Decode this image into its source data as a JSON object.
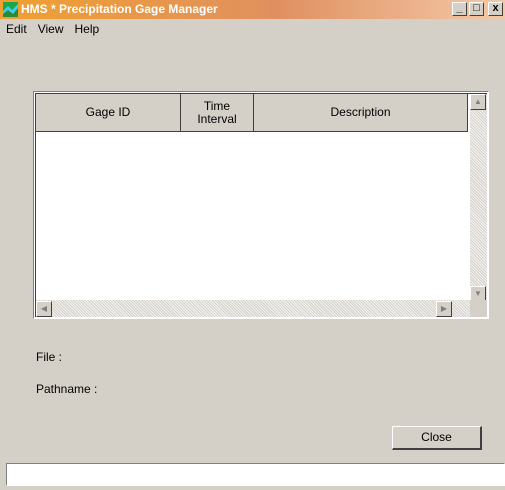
{
  "window": {
    "title": "HMS * Precipitation Gage Manager",
    "controls": {
      "minimize": "_",
      "maximize": "□",
      "close": "x"
    }
  },
  "menu": {
    "items": [
      "Edit",
      "View",
      "Help"
    ]
  },
  "table": {
    "columns": [
      {
        "line1": "Gage ID",
        "line2": ""
      },
      {
        "line1": "Time",
        "line2": "Interval"
      },
      {
        "line1": "Description",
        "line2": ""
      }
    ],
    "rows": []
  },
  "info": {
    "file_label": "File :",
    "pathname_label": "Pathname :"
  },
  "buttons": {
    "close": "Close"
  },
  "status": {
    "text": ""
  },
  "colors": {
    "title_gradient_start": "#f0a030",
    "title_gradient_end": "#f3c9a8",
    "face": "#d4d0c8"
  }
}
